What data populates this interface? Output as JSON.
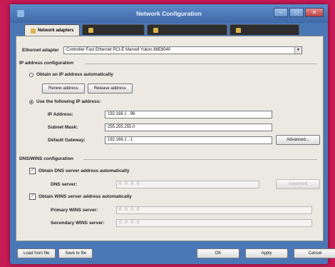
{
  "window": {
    "title": "Network Configuration",
    "minimize": "–",
    "maximize": "□",
    "close": "✕"
  },
  "tabs": [
    {
      "label": "Network adapters"
    },
    {
      "label": ""
    },
    {
      "label": ""
    },
    {
      "label": ""
    }
  ],
  "adapter": {
    "label": "Ethernet adapter",
    "value": "Controller Fast Ethernet PCI-E Marvell Yukon 88E8040"
  },
  "ip_group": {
    "title": "IP address configuration",
    "auto_label": "Obtain an IP address automatically",
    "renew_label": "Renew address",
    "release_label": "Release address",
    "manual_label": "Use the following IP address:",
    "ip_label": "IP Address:",
    "ip_value": "192.168.1 . 96",
    "mask_label": "Subnet Mask:",
    "mask_value": "255.255.255.0",
    "gateway_label": "Default Gateway:",
    "gateway_value": "192.168.1 . 1",
    "advanced_label": "Advanced..."
  },
  "dns_group": {
    "title": "DNS/WINS configuration",
    "dns_auto_label": "Obtain DNS server address automatically",
    "dns_server_label": "DNS server:",
    "dns_server_value": "0 . 0 . 0 . 0",
    "advanced_label": "Advanced",
    "wins_auto_label": "Obtain WINS server address automatically",
    "primary_wins_label": "Primary WINS server:",
    "primary_wins_value": "0 . 0 . 0 . 0",
    "secondary_wins_label": "Secondary WINS server:",
    "secondary_wins_value": "0 . 0 . 0 . 0"
  },
  "footer": {
    "load_label": "Load from file",
    "save_label": "Save to file",
    "ok_label": "OK",
    "apply_label": "Apply",
    "cancel_label": "Cancel"
  },
  "checkmark": "✓"
}
